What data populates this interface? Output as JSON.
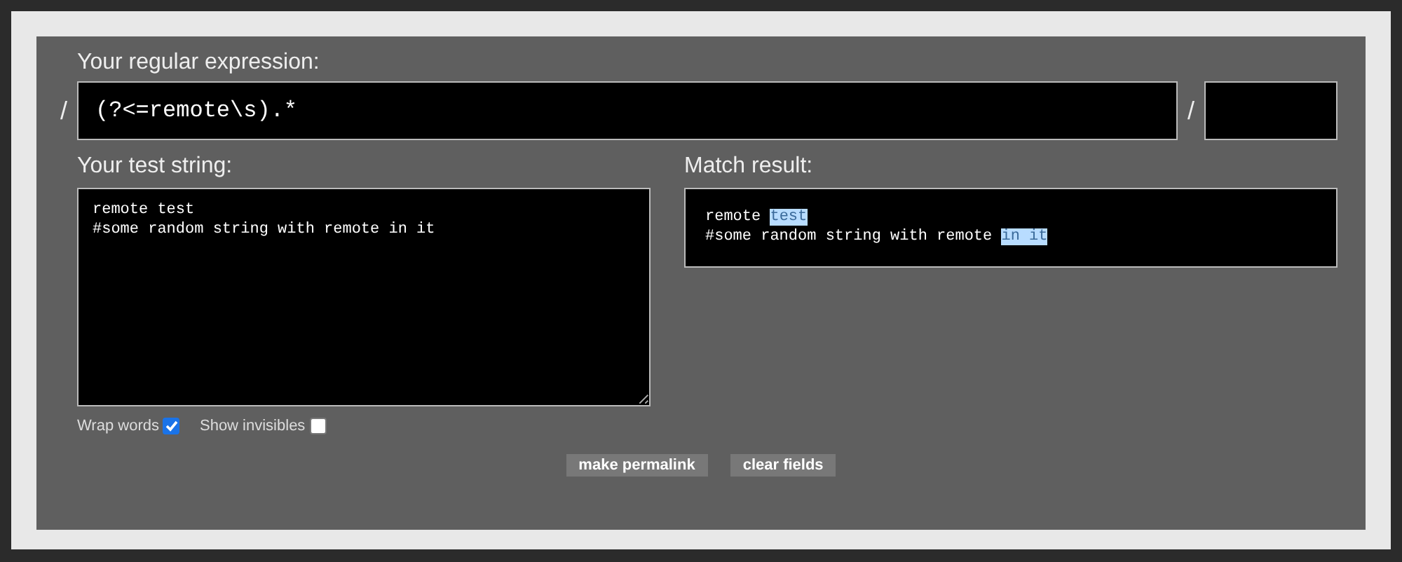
{
  "regex": {
    "label": "Your regular expression:",
    "open_delimiter": "/",
    "value": "(?<=remote\\s).*",
    "close_delimiter": "/"
  },
  "test_string": {
    "label": "Your test string:",
    "lines": [
      "remote test",
      "#some random string with remote in it"
    ]
  },
  "match_result": {
    "label": "Match result:",
    "lines": [
      [
        {
          "text": "remote ",
          "matched": false
        },
        {
          "text": "test",
          "matched": true
        }
      ],
      [
        {
          "text": "#some random string with remote ",
          "matched": false
        },
        {
          "text": "in it",
          "matched": true
        }
      ]
    ]
  },
  "options": [
    {
      "label": "Wrap words",
      "checked": true
    },
    {
      "label": "Show invisibles",
      "checked": false
    }
  ],
  "buttons": [
    "make permalink",
    "clear fields"
  ]
}
